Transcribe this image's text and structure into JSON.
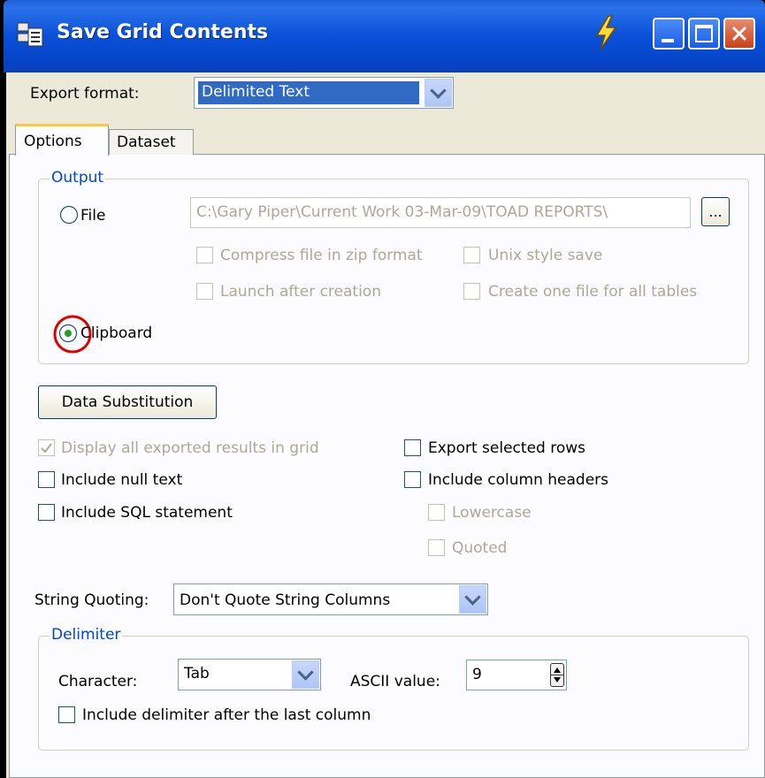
{
  "window": {
    "title": "Save Grid Contents"
  },
  "export_format": {
    "label": "Export format:",
    "value": "Delimited Text"
  },
  "tabs": [
    {
      "label": "Options",
      "active": true
    },
    {
      "label": "Dataset",
      "active": false
    }
  ],
  "output": {
    "group_label": "Output",
    "file_label": "File",
    "file_path": "C:\\Gary Piper\\Current Work 03-Mar-09\\TOAD REPORTS\\",
    "browse_label": "...",
    "compress_label": "Compress file in zip format",
    "unix_label": "Unix style save",
    "launch_label": "Launch after creation",
    "one_file_label": "Create one file for all tables",
    "clipboard_label": "Clipboard",
    "selected": "Clipboard"
  },
  "data_substitution_label": "Data Substitution",
  "options": {
    "display_all": {
      "label": "Display all exported results in grid",
      "checked": true,
      "enabled": false
    },
    "include_null": {
      "label": "Include null text",
      "checked": false
    },
    "include_sql": {
      "label": "Include SQL statement",
      "checked": false
    },
    "export_selected": {
      "label": "Export selected rows",
      "checked": false
    },
    "include_headers": {
      "label": "Include column headers",
      "checked": false
    },
    "lowercase": {
      "label": "Lowercase",
      "checked": false,
      "enabled": false
    },
    "quoted": {
      "label": "Quoted",
      "checked": false,
      "enabled": false
    }
  },
  "string_quoting": {
    "label": "String Quoting:",
    "value": "Don't Quote String Columns"
  },
  "delimiter": {
    "group_label": "Delimiter",
    "character_label": "Character:",
    "character_value": "Tab",
    "ascii_label": "ASCII value:",
    "ascii_value": "9",
    "include_after_last": "Include delimiter after the last column"
  },
  "colors": {
    "titlebar": "#0a50d8",
    "face": "#ece9d8",
    "highlight_circle": "#e00000",
    "group_title": "#0046d5"
  }
}
